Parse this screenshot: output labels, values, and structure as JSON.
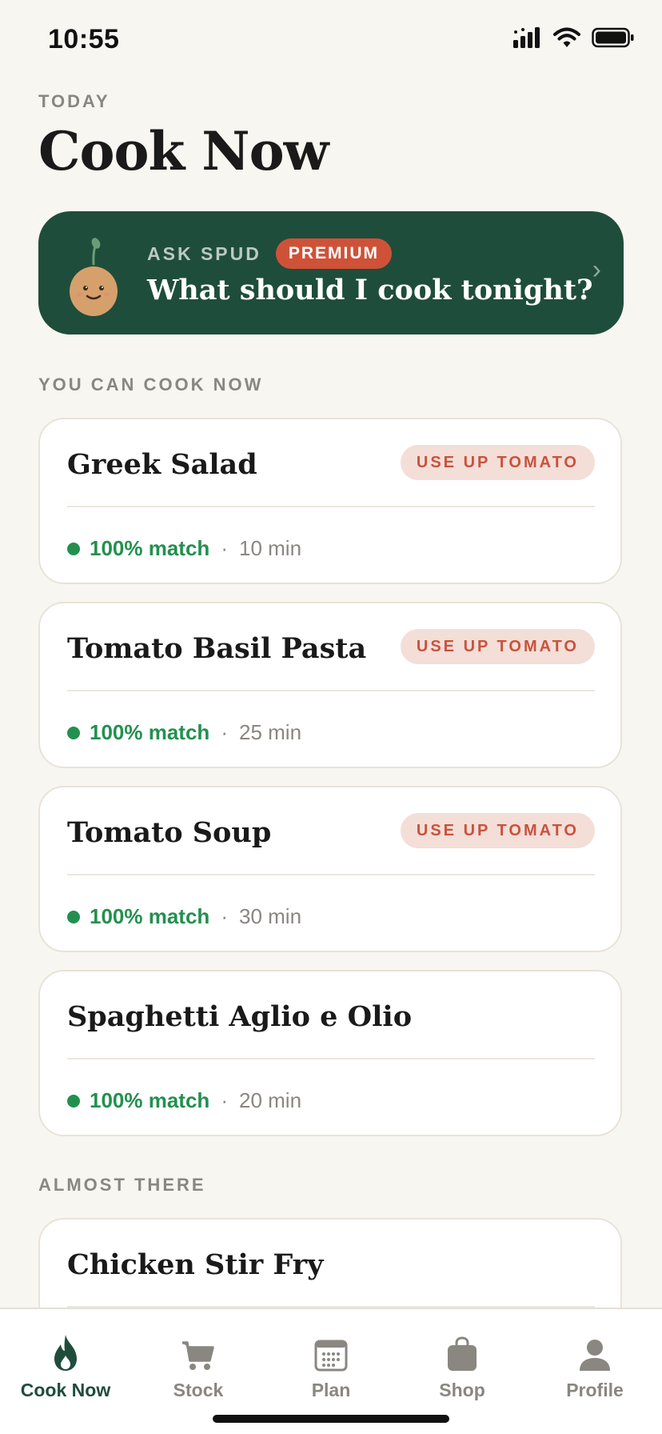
{
  "status_bar": {
    "time": "10:55"
  },
  "header": {
    "eyebrow": "TODAY",
    "title": "Cook Now"
  },
  "spud_banner": {
    "eyebrow": "ASK SPUD",
    "badge": "PREMIUM",
    "question": "What should I cook tonight?",
    "chevron": "›"
  },
  "sections": {
    "cook_now": {
      "label": "YOU CAN COOK NOW"
    },
    "almost_there": {
      "label": "ALMOST THERE"
    }
  },
  "recipes": [
    {
      "title": "Greek Salad",
      "tag": "USE UP TOMATO",
      "match": "100% match",
      "sep": "·",
      "time": "10 min"
    },
    {
      "title": "Tomato Basil Pasta",
      "tag": "USE UP TOMATO",
      "match": "100% match",
      "sep": "·",
      "time": "25 min"
    },
    {
      "title": "Tomato Soup",
      "tag": "USE UP TOMATO",
      "match": "100% match",
      "sep": "·",
      "time": "30 min"
    },
    {
      "title": "Spaghetti Aglio e Olio",
      "match": "100% match",
      "sep": "·",
      "time": "20 min"
    }
  ],
  "almost_there": [
    {
      "title": "Chicken Stir Fry"
    }
  ],
  "tabs": [
    {
      "label": "Cook Now",
      "icon": "flame-icon",
      "active": true
    },
    {
      "label": "Stock",
      "icon": "cart-icon",
      "active": false
    },
    {
      "label": "Plan",
      "icon": "calendar-icon",
      "active": false
    },
    {
      "label": "Shop",
      "icon": "bag-icon",
      "active": false
    },
    {
      "label": "Profile",
      "icon": "person-icon",
      "active": false
    }
  ],
  "colors": {
    "background": "#f8f6f1",
    "brand_green": "#1f4d3b",
    "premium": "#cf5238",
    "match_green": "#23904f",
    "tag_bg": "#f4ded8",
    "tag_text": "#c9523c"
  }
}
